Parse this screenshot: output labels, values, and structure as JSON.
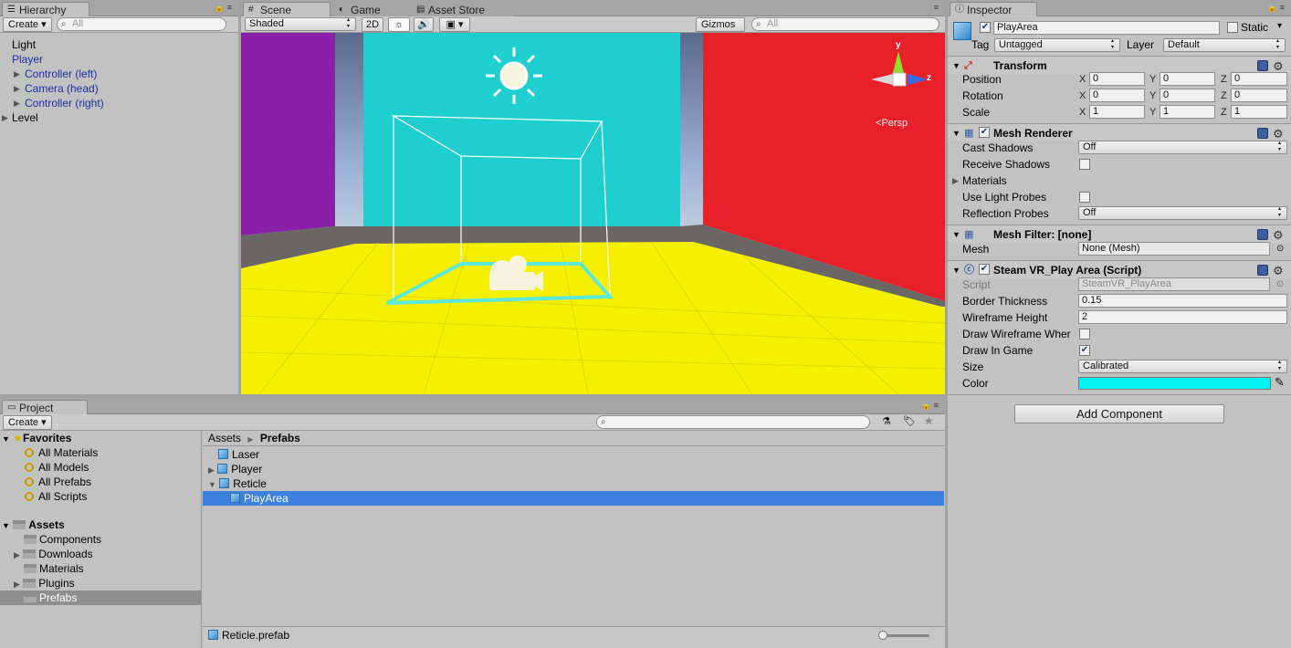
{
  "hierarchy": {
    "tab": "Hierarchy",
    "create": "Create",
    "search_placeholder": "All",
    "items": [
      {
        "label": "Light",
        "color": "#000000"
      },
      {
        "label": "Player",
        "color": "#1a2fa0"
      },
      {
        "label": "Controller (left)",
        "color": "#1a2fa0"
      },
      {
        "label": "Camera (head)",
        "color": "#1a2fa0"
      },
      {
        "label": "Controller (right)",
        "color": "#1a2fa0"
      },
      {
        "label": "Level",
        "color": "#000000"
      }
    ]
  },
  "scene": {
    "tabs": [
      "Scene",
      "Game",
      "Asset Store"
    ],
    "shading": "Shaded",
    "mode_2d": "2D",
    "gizmos": "Gizmos",
    "search_placeholder": "All",
    "persp_label": "Persp",
    "gizmo_y": "y",
    "gizmo_z": "z",
    "colors": {
      "left_wall": "#8a1fa8",
      "back_wall": "#1fcfcf",
      "right_wall": "#e8202a",
      "floor": "#f5f000",
      "bounds": "#42e8ff"
    }
  },
  "inspector": {
    "tab": "Inspector",
    "object_name": "PlayArea",
    "static_label": "Static",
    "tag_label": "Tag",
    "tag_value": "Untagged",
    "layer_label": "Layer",
    "layer_value": "Default",
    "transform": {
      "title": "Transform",
      "position_label": "Position",
      "rotation_label": "Rotation",
      "scale_label": "Scale",
      "axes": [
        "X",
        "Y",
        "Z"
      ],
      "position": [
        "0",
        "0",
        "0"
      ],
      "rotation": [
        "0",
        "0",
        "0"
      ],
      "scale": [
        "1",
        "1",
        "1"
      ]
    },
    "mesh_renderer": {
      "title": "Mesh Renderer",
      "cast_shadows_label": "Cast Shadows",
      "cast_shadows": "Off",
      "receive_shadows_label": "Receive Shadows",
      "materials_label": "Materials",
      "light_probes_label": "Use Light Probes",
      "reflection_probes_label": "Reflection Probes",
      "reflection_probes": "Off"
    },
    "mesh_filter": {
      "title": "Mesh Filter: [none]",
      "mesh_label": "Mesh",
      "mesh_value": "None (Mesh)"
    },
    "play_area": {
      "title": "Steam VR_Play Area (Script)",
      "script_label": "Script",
      "script_value": "SteamVR_PlayArea",
      "border_label": "Border Thickness",
      "border_value": "0.15",
      "wire_height_label": "Wireframe Height",
      "wire_height_value": "2",
      "draw_wire_label": "Draw Wireframe Wher",
      "draw_in_game_label": "Draw In Game",
      "size_label": "Size",
      "size_value": "Calibrated",
      "color_label": "Color",
      "color_value": "#00f2f2"
    },
    "add_component": "Add Component"
  },
  "project": {
    "tab": "Project",
    "create": "Create",
    "favorites_label": "Favorites",
    "favorites": [
      "All Materials",
      "All Models",
      "All Prefabs",
      "All Scripts"
    ],
    "assets_label": "Assets",
    "folders": [
      "Components",
      "Downloads",
      "Materials",
      "Plugins",
      "Prefabs"
    ],
    "breadcrumb_root": "Assets",
    "breadcrumb_current": "Prefabs",
    "files": [
      "Laser",
      "Player",
      "Reticle",
      "PlayArea"
    ],
    "footer_file": "Reticle.prefab"
  }
}
